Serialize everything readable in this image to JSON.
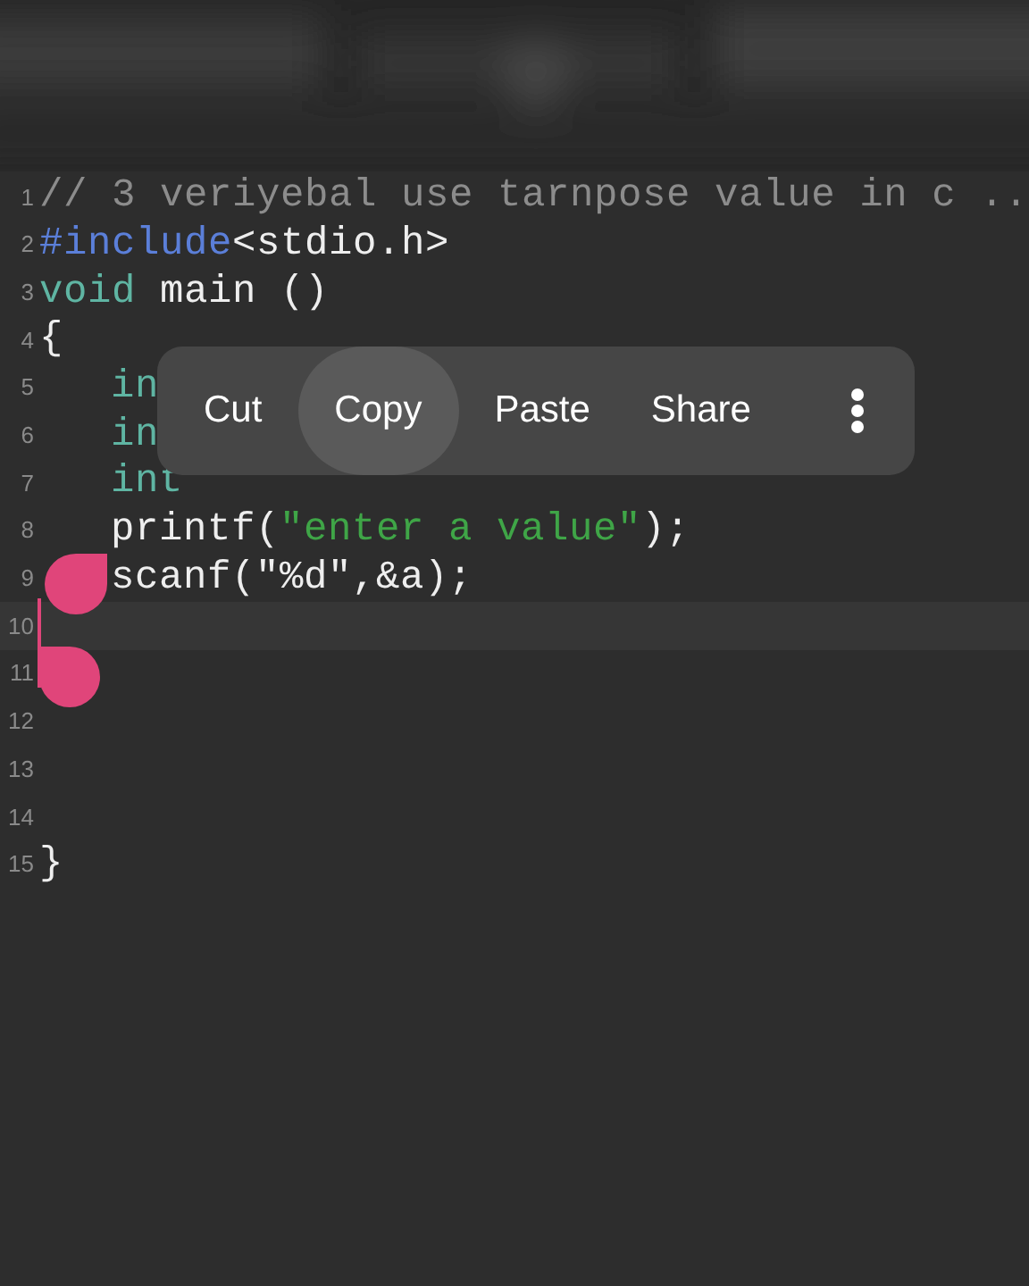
{
  "editor": {
    "lines": [
      {
        "number": "1",
        "tokens": [
          {
            "kind": "comment",
            "text": "// 3 veriyebal use tarnpose value in c .."
          }
        ]
      },
      {
        "number": "2",
        "tokens": [
          {
            "kind": "keyword",
            "text": "#include"
          },
          {
            "kind": "plain",
            "text": "<stdio.h>"
          }
        ]
      },
      {
        "number": "3",
        "tokens": [
          {
            "kind": "type",
            "text": "void"
          },
          {
            "kind": "plain",
            "text": " main ()"
          }
        ]
      },
      {
        "number": "4",
        "tokens": [
          {
            "kind": "plain",
            "text": "{"
          }
        ]
      },
      {
        "number": "5",
        "indented": true,
        "tokens": [
          {
            "kind": "type",
            "text": "in"
          }
        ]
      },
      {
        "number": "6",
        "indented": true,
        "tokens": [
          {
            "kind": "type",
            "text": "in"
          }
        ]
      },
      {
        "number": "7",
        "indented": true,
        "tokens": [
          {
            "kind": "type",
            "text": "int"
          }
        ]
      },
      {
        "number": "8",
        "indented": true,
        "tokens": [
          {
            "kind": "plain",
            "text": "printf("
          },
          {
            "kind": "string",
            "text": "\"enter a value\""
          },
          {
            "kind": "plain",
            "text": ");"
          }
        ]
      },
      {
        "number": "9",
        "indented": true,
        "tokens": [
          {
            "kind": "plain",
            "text": "scanf(\"%d\",&a);"
          }
        ]
      },
      {
        "number": "10",
        "current": true
      },
      {
        "number": "11"
      },
      {
        "number": "12"
      },
      {
        "number": "13"
      },
      {
        "number": "14"
      },
      {
        "number": "15",
        "tokens": [
          {
            "kind": "plain",
            "text": "}"
          }
        ]
      }
    ]
  },
  "context_menu": {
    "items": [
      {
        "label": "Cut",
        "selected": false
      },
      {
        "label": "Copy",
        "selected": true
      },
      {
        "label": "Paste",
        "selected": false
      },
      {
        "label": "Share",
        "selected": false
      }
    ]
  }
}
